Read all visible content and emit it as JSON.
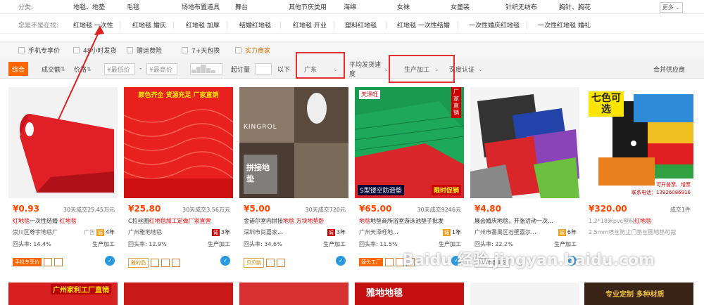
{
  "categories": {
    "label": "分类:",
    "items": [
      "地毯、地垫",
      "毛毯",
      "场地布置道具",
      "舞台",
      "其他节庆类用",
      "海绵",
      "女袜",
      "女童装",
      "针织无纺布",
      "胸针、胸花"
    ],
    "more": "更多"
  },
  "wanted": {
    "label": "您是不是在找:",
    "items": [
      "红地毯 一次性",
      "红地毯 婚庆",
      "红地毯 加厚",
      "结婚红地毯",
      "红地毯 开业",
      "塑料红地毯",
      "红地毯 一次性结婚",
      "一次性婚庆红地毯",
      "一次性红地毯 婚礼"
    ]
  },
  "options": [
    "手机专享价",
    "48小时发货",
    "赠运费险",
    "7+天包换",
    "实力商家"
  ],
  "sort": {
    "tabs": [
      "综合",
      "成交额",
      "价格"
    ],
    "min_price": "¥最低价",
    "max_price": "¥最高价",
    "dash": "-",
    "min_order": "起订量",
    "below": "以下",
    "region": "广东",
    "ship_speed": "平均发货速度",
    "business": "生产加工",
    "auth": "深度认证",
    "merge": "合并供应商"
  },
  "products": [
    {
      "price": "¥0.93",
      "sales": "30天成交25.45万元",
      "title_a": "红地毯",
      "title_b": "一次性结婚 ",
      "title_c": "红地毯",
      "shop": "崇川区尊宇地毯厂",
      "ad": "广告",
      "years": "4年",
      "rate_label": "回头率:",
      "rate": "14.4%",
      "mode": "生产加工",
      "tags": [
        "手机专享价"
      ]
    },
    {
      "price": "¥25.80",
      "sales": "30天成交3.56万元",
      "title_a": "",
      "title_b": "C拉丝圈",
      "title_c": "红地毯加工定做厂家直营",
      "shop": "广州雅地地毯",
      "ad": "",
      "years": "3年",
      "rate_label": "回头率:",
      "rate": "12.9%",
      "mode": "生产加工",
      "tags": [
        "雅的品"
      ]
    },
    {
      "price": "¥5.00",
      "sales": "30天成交720元",
      "title_a": "",
      "title_b": "金诺尔室内拼接",
      "title_c": "地毯 方块地垫卧",
      "shop": "深圳市尚嘉家...",
      "ad": "",
      "years": "3年",
      "rate_label": "回头率:",
      "rate": "34.6%",
      "mode": "生产加工",
      "tags": [
        "贝贝鹏"
      ]
    },
    {
      "price": "¥65.00",
      "sales": "30天成交9246元",
      "title_a": "",
      "title_b": "地毯",
      "title_c": "地垫商所浴室游泳池垫子批发",
      "shop": "广州天泽旺地...",
      "ad": "",
      "years": "1年",
      "rate_label": "回头率:",
      "rate": "11.5%",
      "mode": "生产加工",
      "tags": [
        "源头工厂"
      ]
    },
    {
      "price": "¥4.80",
      "sales": "",
      "title_a": "",
      "title_b": "展会婚庆",
      "title_c": "地毯，开张活动一次...",
      "shop": "广州市番禺区石壁嘉尔...",
      "ad": "广告",
      "years": "6年",
      "rate_label": "回头率:",
      "rate": "22.2%",
      "mode": "生产加工",
      "tags": [
        "广州市番禺区"
      ]
    },
    {
      "price": "¥320.00",
      "sales": "成交1件",
      "title_a": "",
      "title_b": "1.2*18米pvc塑料",
      "title_c": "红地毯",
      "shop": "2.5mm喷丝防尘门垫丝圈地垫可裁",
      "ad": "广告",
      "years": "",
      "rate_label": "",
      "rate": "",
      "mode": "",
      "tags": []
    }
  ],
  "image_texts": {
    "p2_banner": "颜色齐全 货源充足 厂家直销",
    "p3_brand": "KINGROL",
    "p3_label": "拼接地垫",
    "p4_brand": "天泽旺",
    "p4_vert": "厂家直销",
    "p4_bottom": "S型镂空防滑垫",
    "p4_promo": "限时促销",
    "p6_seven": "七色可选",
    "p6_custom": "可开普票、增票",
    "p6_phone": "联系电话：13926086916",
    "b1": "广州家利工厂直销",
    "b4": "雅地地毯",
    "b6": "专业定制 多种材质"
  },
  "watermark": "Baidu 经验 jingyan.baidu.com"
}
